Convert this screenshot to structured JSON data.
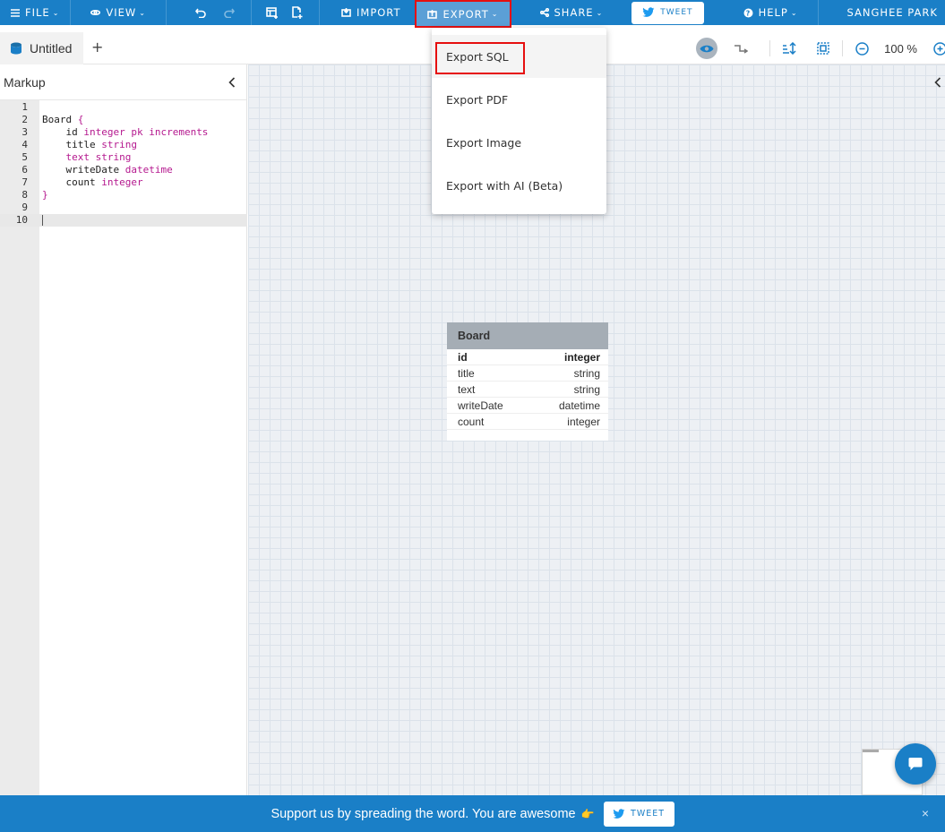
{
  "topbar": {
    "file_label": "FILE",
    "view_label": "VIEW",
    "import_label": "IMPORT",
    "export_label": "EXPORT",
    "share_label": "SHARE",
    "tweet_label": "TWEET",
    "help_label": "HELP",
    "user_name": "SANGHEE PARK"
  },
  "tabs": {
    "current_tab": "Untitled",
    "add_tab": "+"
  },
  "toolbar": {
    "zoom_level": "100 %"
  },
  "markup": {
    "title": "Markup",
    "lines": [
      {
        "num": "1",
        "parts": []
      },
      {
        "num": "2",
        "parts": [
          {
            "t": "Board ",
            "c": ""
          },
          {
            "t": "{",
            "c": "kw"
          }
        ]
      },
      {
        "num": "3",
        "parts": [
          {
            "t": "    id ",
            "c": ""
          },
          {
            "t": "integer pk increments",
            "c": "kw"
          }
        ]
      },
      {
        "num": "4",
        "parts": [
          {
            "t": "    title ",
            "c": ""
          },
          {
            "t": "string",
            "c": "kw"
          }
        ]
      },
      {
        "num": "5",
        "parts": [
          {
            "t": "    text string",
            "c": "kw"
          }
        ]
      },
      {
        "num": "6",
        "parts": [
          {
            "t": "    writeDate ",
            "c": ""
          },
          {
            "t": "datetime",
            "c": "kw"
          }
        ]
      },
      {
        "num": "7",
        "parts": [
          {
            "t": "    count ",
            "c": ""
          },
          {
            "t": "integer",
            "c": "kw"
          }
        ]
      },
      {
        "num": "8",
        "parts": [
          {
            "t": "}",
            "c": "kw"
          }
        ]
      },
      {
        "num": "9",
        "parts": []
      },
      {
        "num": "10",
        "parts": [],
        "active": true
      }
    ]
  },
  "export_menu": {
    "items": [
      "Export SQL",
      "Export PDF",
      "Export Image",
      "Export with AI (Beta)"
    ]
  },
  "board_table": {
    "name": "Board",
    "columns": [
      {
        "name": "id",
        "type": "integer",
        "pk": true
      },
      {
        "name": "title",
        "type": "string"
      },
      {
        "name": "text",
        "type": "string"
      },
      {
        "name": "writeDate",
        "type": "datetime"
      },
      {
        "name": "count",
        "type": "integer"
      }
    ]
  },
  "banner": {
    "message": "Support us by spreading the word. You are awesome",
    "emoji": "👉",
    "tweet_label": "TWEET",
    "close": "×"
  },
  "colors": {
    "accent": "#1a7fc7",
    "keyword": "#b5198f",
    "highlight": "#e60f0f"
  }
}
